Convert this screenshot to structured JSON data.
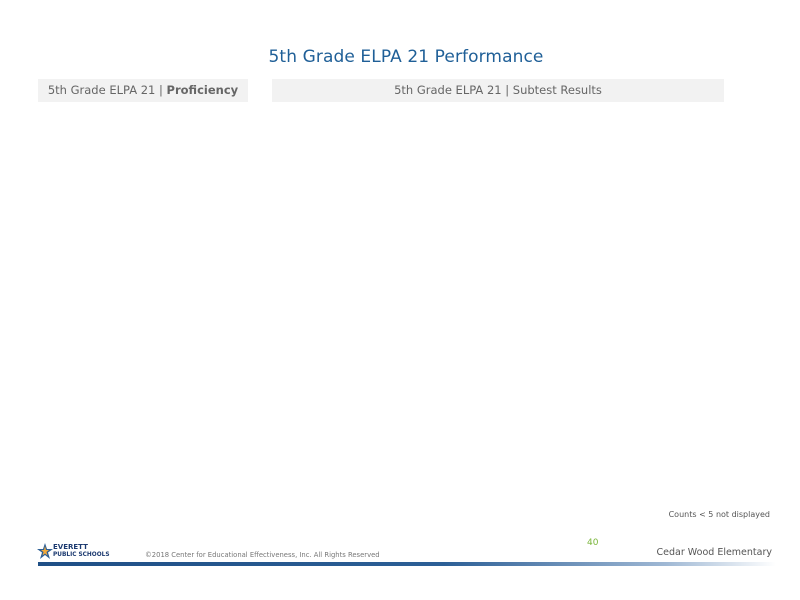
{
  "page": {
    "title": "5th Grade ELPA 21 Performance"
  },
  "panels": {
    "proficiency": {
      "prefix": "5th Grade ELPA 21 | ",
      "bold": "Proficiency"
    },
    "subtest": {
      "text": "5th Grade ELPA 21 | Subtest Results"
    }
  },
  "footer": {
    "counts_note": "Counts < 5 not displayed",
    "page_number": "40",
    "school_name": "Cedar Wood Elementary",
    "copyright": "©2018 Center for Educational Effectiveness, Inc. All Rights Reserved",
    "logo": {
      "line1": "EVERETT",
      "line2": "PUBLIC SCHOOLS",
      "icon": "star-icon"
    }
  },
  "colors": {
    "title": "#1f5f97",
    "header_bg": "#f2f2f2",
    "page_number": "#7ab53a",
    "footer_bar": "#1f4f86"
  }
}
